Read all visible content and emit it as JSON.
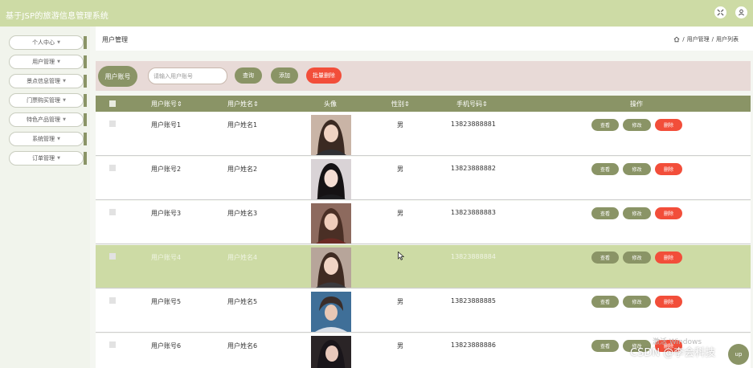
{
  "app": {
    "title": "基于JSP的旅游信息管理系统"
  },
  "topbar": {
    "icons": [
      "expand-icon",
      "user-icon"
    ]
  },
  "sidebar": {
    "items": [
      {
        "label": "个人中心"
      },
      {
        "label": "用户管理"
      },
      {
        "label": "景点信息管理"
      },
      {
        "label": "门票购买管理"
      },
      {
        "label": "特色产品管理"
      },
      {
        "label": "系统管理"
      },
      {
        "label": "订单管理"
      }
    ]
  },
  "page": {
    "title": "用户管理",
    "breadcrumb": {
      "level1": "用户管理",
      "level2": "用户列表",
      "sep": "/"
    }
  },
  "search": {
    "label": "用户账号",
    "placeholder": "请输入用户账号",
    "query_button": "查询",
    "add_button": "添加",
    "batch_delete_button": "批量删除"
  },
  "table": {
    "columns": {
      "account": "用户账号",
      "name": "用户姓名",
      "avatar": "头像",
      "gender": "性别",
      "phone": "手机号码",
      "actions": "操作"
    },
    "action_labels": {
      "view": "查看",
      "edit": "修改",
      "delete": "删除"
    },
    "rows": [
      {
        "account": "用户账号1",
        "name": "用户姓名1",
        "gender": "男",
        "phone": "13823888881"
      },
      {
        "account": "用户账号2",
        "name": "用户姓名2",
        "gender": "男",
        "phone": "13823888882"
      },
      {
        "account": "用户账号3",
        "name": "用户姓名3",
        "gender": "男",
        "phone": "13823888883"
      },
      {
        "account": "用户账号4",
        "name": "用户姓名4",
        "gender": "",
        "phone": "13823888884"
      },
      {
        "account": "用户账号5",
        "name": "用户姓名5",
        "gender": "男",
        "phone": "13823888885"
      },
      {
        "account": "用户账号6",
        "name": "用户姓名6",
        "gender": "男",
        "phone": "13823888886"
      }
    ],
    "hovered_row": 4
  },
  "overlay": {
    "watermark": "CSDN @李会科技",
    "windows_ghost": "激活 Windows",
    "corner_label": "up"
  },
  "colors": {
    "topbar": "#cddba5",
    "accent": "#8a9466",
    "danger": "#f24e3a",
    "searchbar": "#e8dad7"
  }
}
